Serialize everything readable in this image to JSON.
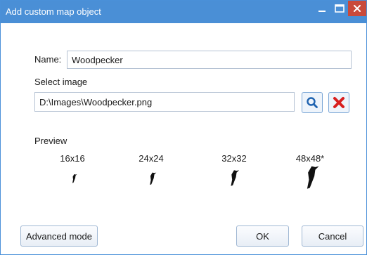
{
  "window": {
    "title": "Add custom map object",
    "controls": {
      "minimize": "minimize-icon",
      "maximize": "maximize-icon",
      "close": "close-icon"
    }
  },
  "form": {
    "name_label": "Name:",
    "name_value": "Woodpecker",
    "select_image_label": "Select image",
    "image_path": "D:\\Images\\Woodpecker.png",
    "browse_icon": "search-icon",
    "clear_icon": "delete-icon"
  },
  "preview": {
    "label": "Preview",
    "sizes": [
      "16x16",
      "24x24",
      "32x32",
      "48x48*"
    ]
  },
  "buttons": {
    "advanced": "Advanced mode",
    "ok": "OK",
    "cancel": "Cancel"
  },
  "colors": {
    "titlebar": "#4a8fd6",
    "close_button": "#c94a3b",
    "browse_icon": "#1f63b0",
    "clear_icon": "#d81e1e"
  }
}
